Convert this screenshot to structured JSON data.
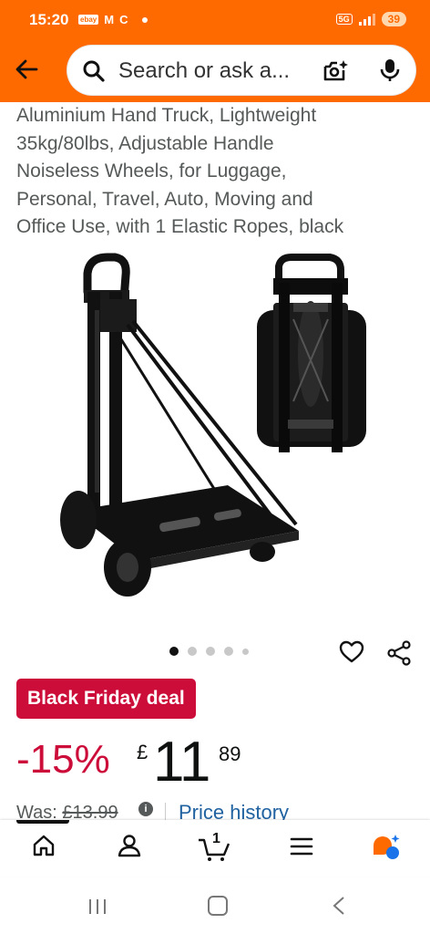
{
  "status_bar": {
    "time": "15:20",
    "notif_labels": [
      "ebay",
      "M",
      "C"
    ],
    "network": "5G",
    "battery": "39"
  },
  "search": {
    "placeholder": "Search or ask a..."
  },
  "product": {
    "title_lines": [
      "Aluminium Hand Truck, Lightweight",
      "35kg/80lbs, Adjustable Handle",
      "Noiseless Wheels, for Luggage,",
      "Personal, Travel, Auto, Moving and",
      "Office Use, with 1 Elastic Ropes, black"
    ],
    "gallery": {
      "image_count": 5,
      "active_index": 0
    },
    "deal_badge": "Black Friday deal",
    "discount": "-15%",
    "currency": "£",
    "price_whole": "11",
    "price_fraction": "89",
    "was_label": "Was:",
    "was_price": "£13.99",
    "info_icon": "i",
    "price_history_link": "Price history"
  },
  "bottom_nav": {
    "cart_count": "1",
    "icons": [
      "home-icon",
      "account-icon",
      "cart-icon",
      "menu-icon",
      "rufus-icon"
    ]
  },
  "colors": {
    "brand_orange": "#ff6a00",
    "deal_red": "#cc0c39",
    "link_blue": "#2162a1"
  }
}
